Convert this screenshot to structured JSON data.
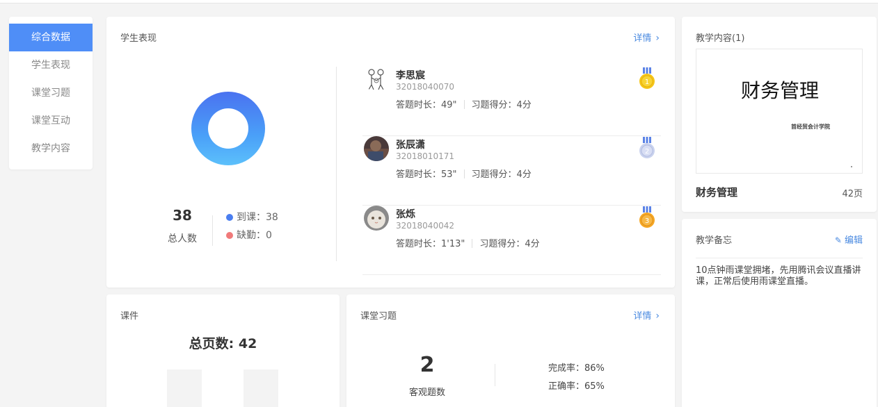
{
  "sidebar": {
    "items": [
      {
        "label": "综合数据",
        "active": true
      },
      {
        "label": "学生表现"
      },
      {
        "label": "课堂习题"
      },
      {
        "label": "课堂互动"
      },
      {
        "label": "教学内容"
      }
    ]
  },
  "performance": {
    "title": "学生表现",
    "detail_label": "详情",
    "total_count": "38",
    "total_label": "总人数",
    "present_label": "到课：38",
    "absent_label": "缺勤：0",
    "colors": {
      "present": "#4a7ef0",
      "absent": "#f07a7a"
    },
    "students": [
      {
        "name": "李思宸",
        "id": "32018040070",
        "time": "答题时长：49\"",
        "score": "习题得分：4分",
        "rank": "1"
      },
      {
        "name": "张辰潇",
        "id": "32018010171",
        "time": "答题时长：53\"",
        "score": "习题得分：4分",
        "rank": "2"
      },
      {
        "name": "张烁",
        "id": "32018040042",
        "time": "答题时长：1'13\"",
        "score": "习题得分：4分",
        "rank": "3"
      }
    ]
  },
  "content": {
    "title": "教学内容(1)",
    "slide_title": "财务管理",
    "slide_subtitle": "首经贸会计学院",
    "doc_name": "财务管理",
    "doc_pages": "42页"
  },
  "memo": {
    "title": "教学备忘",
    "edit_label": "编辑",
    "text": "10点钟雨课堂拥堵，先用腾讯会议直播讲课，正常后使用雨课堂直播。"
  },
  "courseware": {
    "title": "课件",
    "total_pages": "总页数: 42"
  },
  "exercises": {
    "title": "课堂习题",
    "detail_label": "详情",
    "count": "2",
    "count_label": "客观题数",
    "completion": "完成率：86%",
    "accuracy": "正确率：65%"
  }
}
